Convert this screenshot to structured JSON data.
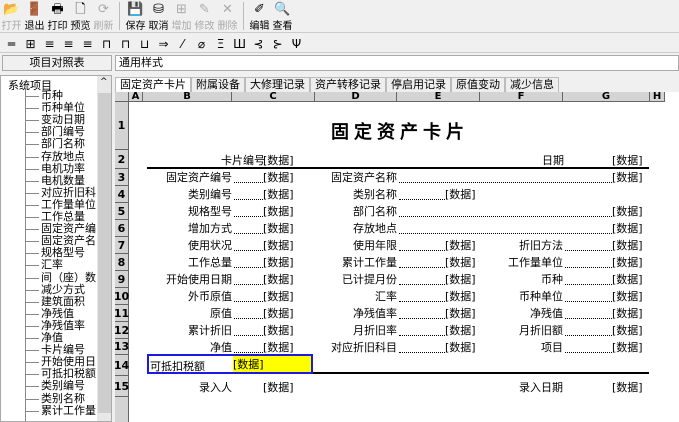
{
  "toolbar": [
    {
      "label": "打开",
      "icon": "folder-open-icon",
      "glyph": "📂",
      "disabled": true
    },
    {
      "label": "退出",
      "icon": "exit-icon",
      "glyph": "🚪",
      "disabled": false
    },
    {
      "label": "打印",
      "icon": "printer-icon",
      "glyph": "🖶",
      "disabled": false
    },
    {
      "label": "预览",
      "icon": "preview-icon",
      "glyph": "🗋",
      "disabled": false
    },
    {
      "label": "刷新",
      "icon": "refresh-icon",
      "glyph": "⟳",
      "disabled": true
    },
    {
      "label": "保存",
      "icon": "save-icon",
      "glyph": "💾",
      "disabled": false
    },
    {
      "label": "取消",
      "icon": "cancel-icon",
      "glyph": "⛁",
      "disabled": false
    },
    {
      "label": "增加",
      "icon": "add-icon",
      "glyph": "⊞",
      "disabled": true
    },
    {
      "label": "修改",
      "icon": "edit-icon",
      "glyph": "✎",
      "disabled": true
    },
    {
      "label": "删除",
      "icon": "delete-icon",
      "glyph": "✕",
      "disabled": true
    },
    {
      "label": "编辑",
      "icon": "design-edit-icon",
      "glyph": "✐",
      "disabled": false
    },
    {
      "label": "查看",
      "icon": "view-icon",
      "glyph": "🔍",
      "disabled": false
    }
  ],
  "format_toolbar": [
    "═",
    "⊞",
    "≡",
    "≡",
    "≡",
    "⊓",
    "⊓",
    "⊔",
    "⇒",
    "⁄",
    "⌀",
    "Ξ",
    "Ш",
    "⊰",
    "⊱",
    "Ψ"
  ],
  "mapping_table_label": "项目对照表",
  "style_field": "通用样式",
  "tree": {
    "root": "系统项目",
    "items": [
      "币种",
      "币种单位",
      "变动日期",
      "部门编号",
      "部门名称",
      "存放地点",
      "电机功率",
      "电机数量",
      "对应折旧科",
      "工作量单位",
      "工作总量",
      "固定资产编",
      "固定资产名",
      "规格型号",
      "汇率",
      "间（座）数",
      "减少方式",
      "建筑面积",
      "净残值",
      "净残值率",
      "净值",
      "卡片编号",
      "开始使用日",
      "可抵扣税额",
      "类别编号",
      "类别名称",
      "累计工作量"
    ]
  },
  "tabs": [
    "固定资产卡片",
    "附属设备",
    "大修理记录",
    "资产转移记录",
    "停启用记录",
    "原值变动",
    "减少信息"
  ],
  "columns": [
    "A",
    "B",
    "C",
    "D",
    "E",
    "F",
    "G",
    "H"
  ],
  "rows": [
    "1",
    "2",
    "3",
    "4",
    "5",
    "6",
    "7",
    "8",
    "9",
    "10",
    "11",
    "12",
    "13",
    "14",
    "15"
  ],
  "card": {
    "title": "固定资产卡片",
    "placeholder": "[数据]",
    "header_left": "卡片编号",
    "header_right": "日期",
    "lines": [
      {
        "l1": "固定资产编号",
        "l2": "固定资产名称",
        "mid": false,
        "l3": "",
        "right": true
      },
      {
        "l1": "类别编号",
        "l2": "类别名称",
        "mid": true,
        "l3": "",
        "right": false
      },
      {
        "l1": "规格型号",
        "l2": "部门名称",
        "mid": false,
        "l3": "",
        "right": true
      },
      {
        "l1": "增加方式",
        "l2": "存放地点",
        "mid": false,
        "l3": "",
        "right": true
      },
      {
        "l1": "使用状况",
        "l2": "使用年限",
        "mid": true,
        "l3": "折旧方法",
        "right": true
      },
      {
        "l1": "工作总量",
        "l2": "累计工作量",
        "mid": true,
        "l3": "工作量单位",
        "right": true
      },
      {
        "l1": "开始使用日期",
        "l2": "已计提月份",
        "mid": true,
        "l3": "币种",
        "right": true
      },
      {
        "l1": "外币原值",
        "l2": "汇率",
        "mid": true,
        "l3": "币种单位",
        "right": true
      },
      {
        "l1": "原值",
        "l2": "净残值率",
        "mid": true,
        "l3": "净残值",
        "right": true
      },
      {
        "l1": "累计折旧",
        "l2": "月折旧率",
        "mid": true,
        "l3": "月折旧额",
        "right": true
      },
      {
        "l1": "净值",
        "l2": "对应折旧科目",
        "mid": true,
        "l3": "项目",
        "right": true
      }
    ],
    "selected_label": "可抵扣税额",
    "footer_left": "录入人",
    "footer_right": "录入日期"
  }
}
